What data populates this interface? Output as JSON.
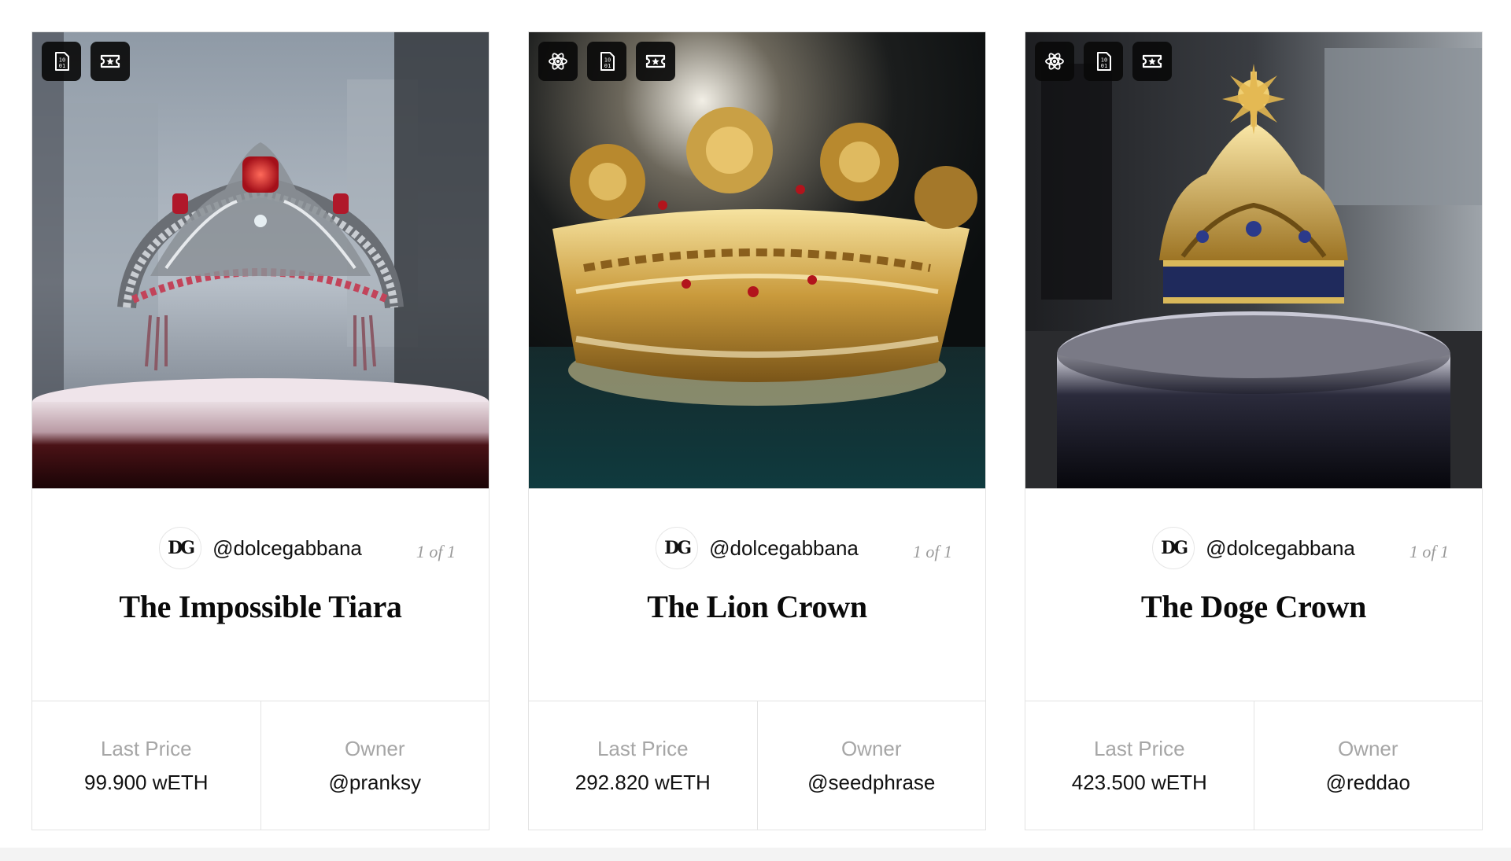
{
  "cards": [
    {
      "creator": "@dolcegabbana",
      "avatar_text": "DG",
      "edition": "1 of 1",
      "title": "The Impossible Tiara",
      "last_price_label": "Last Price",
      "last_price": "99.900 wETH",
      "owner_label": "Owner",
      "owner": "@pranksy",
      "badges": [
        "binary-file-icon",
        "ticket-star-icon"
      ]
    },
    {
      "creator": "@dolcegabbana",
      "avatar_text": "DG",
      "edition": "1 of 1",
      "title": "The Lion Crown",
      "last_price_label": "Last Price",
      "last_price": "292.820 wETH",
      "owner_label": "Owner",
      "owner": "@seedphrase",
      "badges": [
        "atom-icon",
        "binary-file-icon",
        "ticket-star-icon"
      ]
    },
    {
      "creator": "@dolcegabbana",
      "avatar_text": "DG",
      "edition": "1 of 1",
      "title": "The Doge Crown",
      "last_price_label": "Last Price",
      "last_price": "423.500 wETH",
      "owner_label": "Owner",
      "owner": "@reddao",
      "badges": [
        "atom-icon",
        "binary-file-icon",
        "ticket-star-icon"
      ]
    }
  ],
  "colors": {
    "border": "#e3e3e3",
    "muted_text": "#a6a6a6",
    "badge_bg": "#0a0a0a",
    "title_text": "#0a0a0a"
  }
}
